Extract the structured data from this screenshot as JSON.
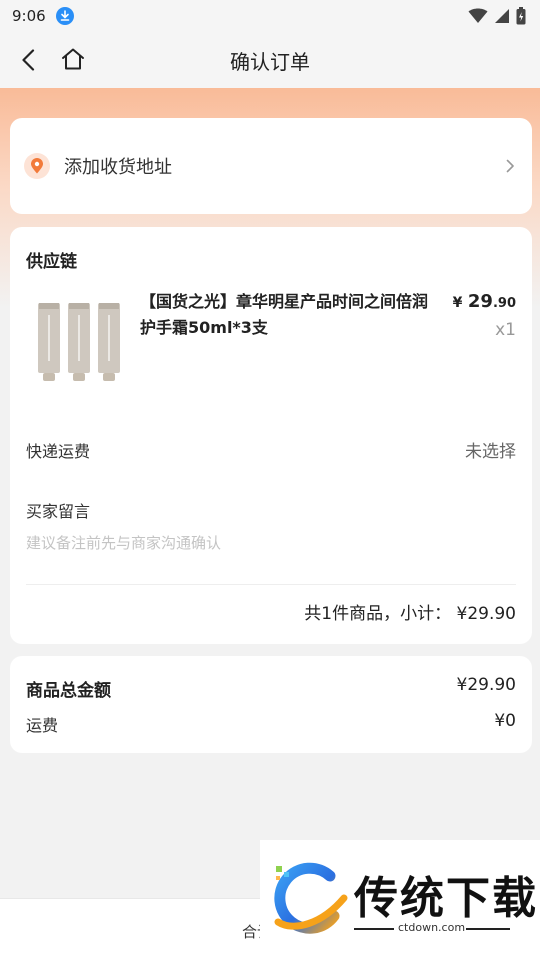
{
  "status_bar": {
    "time": "9:06"
  },
  "nav": {
    "title": "确认订单"
  },
  "address": {
    "label": "添加收货地址"
  },
  "order": {
    "supplier": "供应链",
    "product": {
      "name": "【国货之光】章华明星产品时间之间倍润护手霜50ml*3支",
      "price_currency": "¥",
      "price_int": "29",
      "price_dec": ".90",
      "quantity": "x1"
    },
    "shipping_label": "快递运费",
    "shipping_value": "未选择",
    "memo_label": "买家留言",
    "memo_placeholder": "建议备注前先与商家沟通确认",
    "subtotal": "共1件商品，小计： ¥29.90"
  },
  "summary": {
    "goods_total_label": "商品总金额",
    "goods_total_value": "¥29.90",
    "freight_label": "运费",
    "freight_value": "¥0"
  },
  "bottom_bar": {
    "total_label": "合计"
  },
  "watermark": {
    "text": "传统下载",
    "domain": "ctdown.com"
  },
  "colors": {
    "accent": "#f27a3a",
    "header_gradient": "#f9bb98",
    "background": "#f2f2f2"
  }
}
